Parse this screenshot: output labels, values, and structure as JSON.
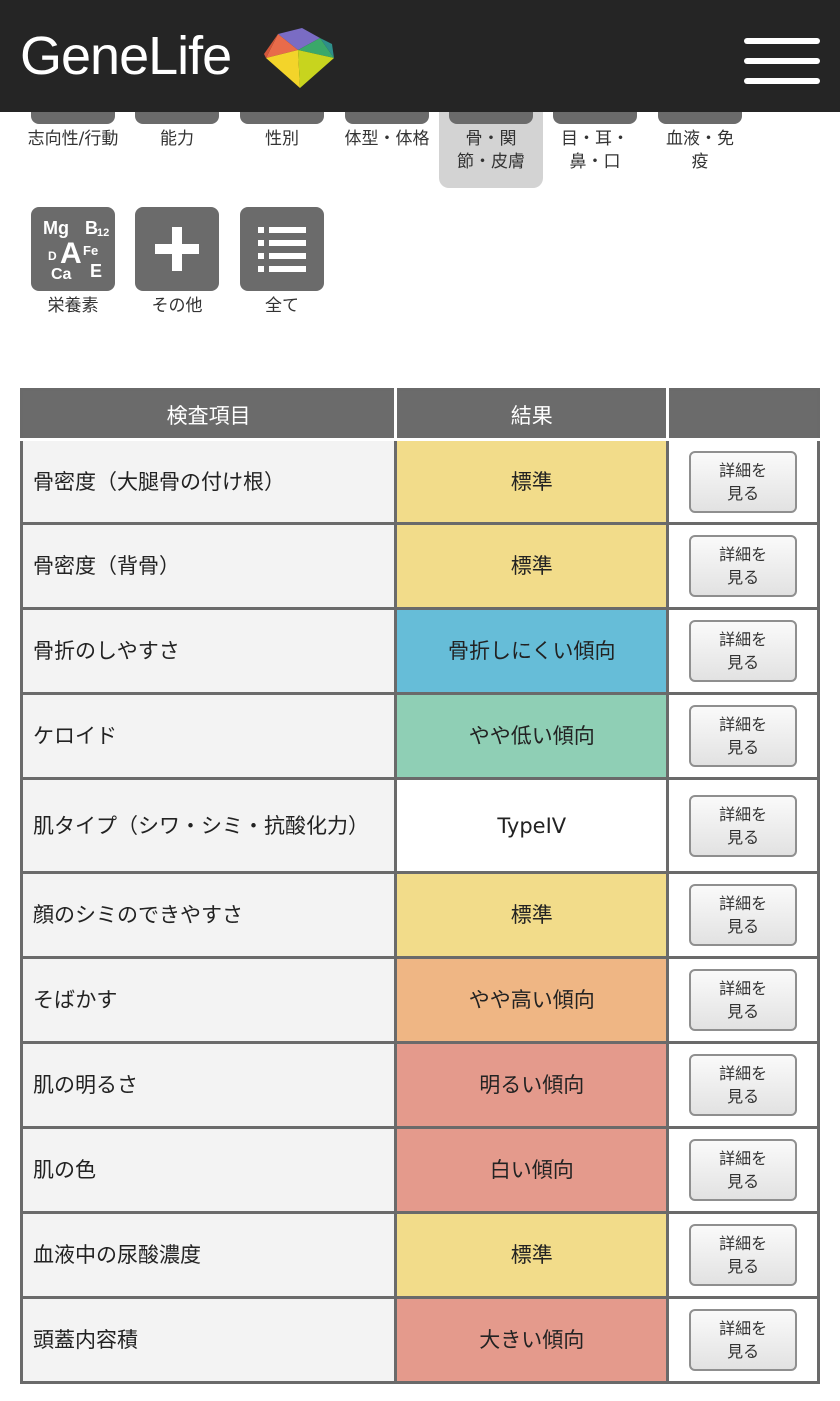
{
  "header": {
    "logo_text": "GeneLife"
  },
  "categories_row1": [
    {
      "label": "志向性/行動"
    },
    {
      "label": "能力"
    },
    {
      "label": "性別"
    },
    {
      "label": "体型・体格"
    },
    {
      "label": "骨・関節・皮膚",
      "active": true
    },
    {
      "label": "目・耳・鼻・口"
    },
    {
      "label": "血液・免疫"
    }
  ],
  "categories_row2": [
    {
      "label": "栄養素",
      "icon": "nutrients-icon",
      "icon_text": {
        "mg": "Mg",
        "b12": "B",
        "b12_sub": "12",
        "d": "D",
        "a": "A",
        "fe": "Fe",
        "ca": "Ca",
        "e": "E"
      }
    },
    {
      "label": "その他",
      "icon": "plus-icon"
    },
    {
      "label": "全て",
      "icon": "list-icon"
    }
  ],
  "table": {
    "headers": [
      "検査項目",
      "結果",
      ""
    ],
    "button_label": "詳細を\n見る",
    "rows": [
      {
        "item": "骨密度（大腿骨の付け根）",
        "result": "標準",
        "color": "#f2dc8a"
      },
      {
        "item": "骨密度（背骨）",
        "result": "標準",
        "color": "#f2dc8a"
      },
      {
        "item": "骨折のしやすさ",
        "result": "骨折しにくい傾向",
        "color": "#66bdd8"
      },
      {
        "item": "ケロイド",
        "result": "やや低い傾向",
        "color": "#8fcfb5"
      },
      {
        "item": "肌タイプ（シワ・シミ・抗酸化力）",
        "result": "TypeIV",
        "color": "#ffffff"
      },
      {
        "item": "顔のシミのできやすさ",
        "result": "標準",
        "color": "#f2dc8a"
      },
      {
        "item": "そばかす",
        "result": "やや高い傾向",
        "color": "#efb684"
      },
      {
        "item": "肌の明るさ",
        "result": "明るい傾向",
        "color": "#e49a8c"
      },
      {
        "item": "肌の色",
        "result": "白い傾向",
        "color": "#e49a8c"
      },
      {
        "item": "血液中の尿酸濃度",
        "result": "標準",
        "color": "#f2dc8a"
      },
      {
        "item": "頭蓋内容積",
        "result": "大きい傾向",
        "color": "#e49a8c"
      }
    ]
  }
}
